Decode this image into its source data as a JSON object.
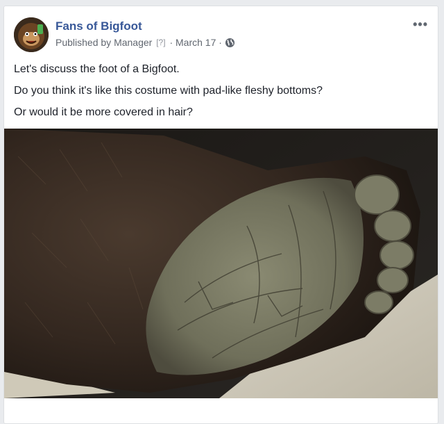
{
  "post": {
    "page_name": "Fans of Bigfoot",
    "published_by_prefix": "Published by",
    "manager": "Manager",
    "badge": "[?]",
    "separator": "·",
    "date": "March 17",
    "privacy_icon": "globe-icon",
    "more_icon": "more-dots-icon",
    "more_label": "•••",
    "lines": [
      "Let's discuss the foot of a Bigfoot.",
      "Do you think it's like this costume with pad-like fleshy bottoms?",
      "Or would it be more covered in hair?"
    ],
    "photo_subject": "hairy-foot-photo"
  },
  "colors": {
    "link": "#385898",
    "meta": "#616770",
    "background": "#e9ebee"
  }
}
